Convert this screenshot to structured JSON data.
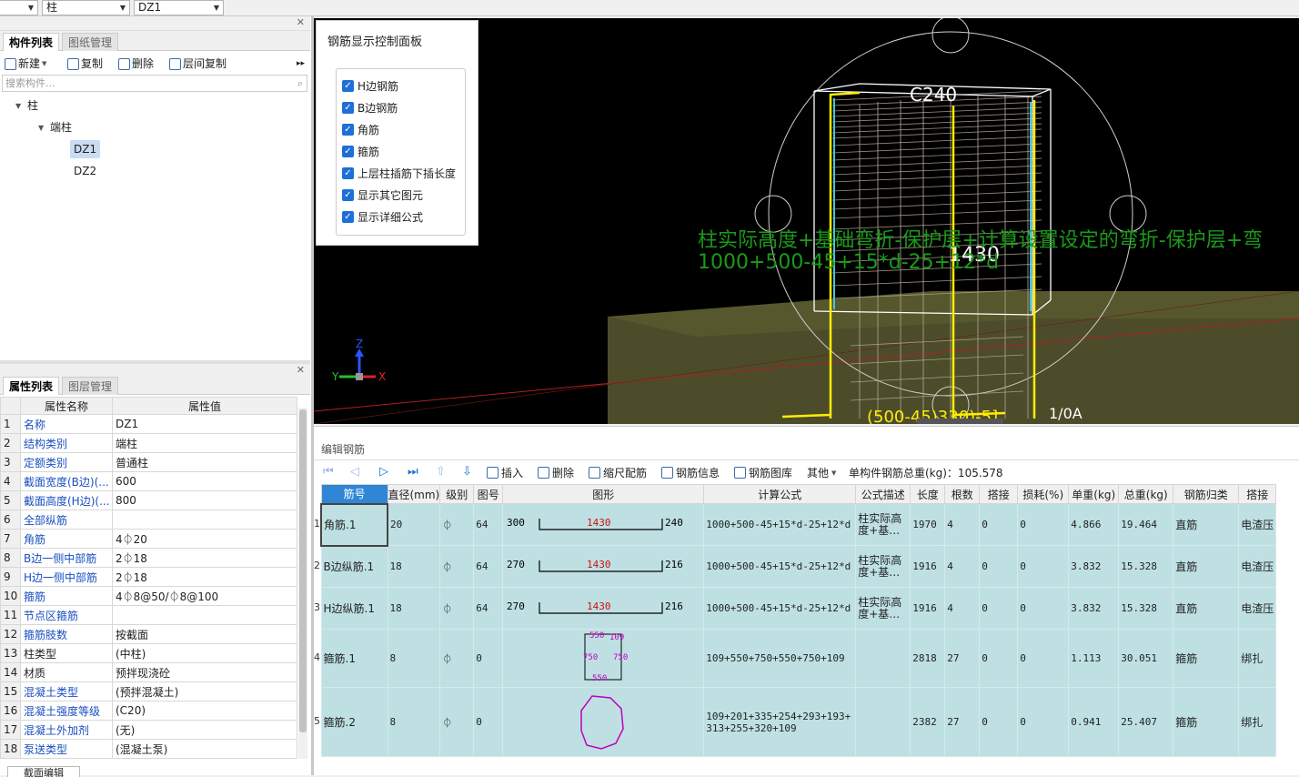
{
  "top_toolbar": {
    "combo1": "",
    "combo2": "柱",
    "combo3": "DZ1"
  },
  "component_panel": {
    "tabs": [
      "构件列表",
      "图纸管理"
    ],
    "toolbar": {
      "new": "新建",
      "copy": "复制",
      "delete": "删除",
      "floor_copy": "层间复制"
    },
    "search_placeholder": "搜索构件...",
    "tree": {
      "root": "柱",
      "group": "端柱",
      "items": [
        "DZ1",
        "DZ2"
      ]
    }
  },
  "property_panel": {
    "tabs": [
      "属性列表",
      "图层管理"
    ],
    "columns": [
      "属性名称",
      "属性值"
    ],
    "rows": [
      {
        "n": "1",
        "name": "名称",
        "value": "DZ1"
      },
      {
        "n": "2",
        "name": "结构类别",
        "value": "端柱"
      },
      {
        "n": "3",
        "name": "定额类别",
        "value": "普通柱"
      },
      {
        "n": "4",
        "name": "截面宽度(B边)(...",
        "value": "600"
      },
      {
        "n": "5",
        "name": "截面高度(H边)(...",
        "value": "800"
      },
      {
        "n": "6",
        "name": "全部纵筋",
        "value": ""
      },
      {
        "n": "7",
        "name": "角筋",
        "value": "4⏀20"
      },
      {
        "n": "8",
        "name": "B边一侧中部筋",
        "value": "2⏀18"
      },
      {
        "n": "9",
        "name": "H边一侧中部筋",
        "value": "2⏀18"
      },
      {
        "n": "10",
        "name": "箍筋",
        "value": "4⏀8@50/⏀8@100"
      },
      {
        "n": "11",
        "name": "节点区箍筋",
        "value": ""
      },
      {
        "n": "12",
        "name": "箍筋肢数",
        "value": "按截面"
      },
      {
        "n": "13",
        "name": "柱类型",
        "value": "(中柱)"
      },
      {
        "n": "14",
        "name": "材质",
        "value": "预拌现浇砼"
      },
      {
        "n": "15",
        "name": "混凝土类型",
        "value": "(预拌混凝土)"
      },
      {
        "n": "16",
        "name": "混凝土强度等级",
        "value": "(C20)"
      },
      {
        "n": "17",
        "name": "混凝土外加剂",
        "value": "(无)"
      },
      {
        "n": "18",
        "name": "泵送类型",
        "value": "(混凝土泵)"
      }
    ],
    "bottom_button": "截面编辑"
  },
  "viewport": {
    "label_top": "C240",
    "label_mid": "1430",
    "formula_line1": "柱实际高度+基础弯折-保护层+计算设置设定的弯折-保护层+弯",
    "formula_line2": "1000+500-45+15*d-25+12*d",
    "label_bottom": "(500-45)330)-5]",
    "label_bottom_right": "1/0A",
    "axis_z": "Z",
    "axis_y": "Y",
    "axis_x": "X"
  },
  "rebar_control_panel": {
    "title": "钢筋显示控制面板",
    "options": [
      "H边钢筋",
      "B边钢筋",
      "角筋",
      "箍筋",
      "上层柱插筋下插长度",
      "显示其它图元",
      "显示详细公式"
    ]
  },
  "edit_rebar": {
    "title": "编辑钢筋",
    "toolbar": {
      "insert": "插入",
      "delete": "删除",
      "scale": "缩尺配筋",
      "info": "钢筋信息",
      "library": "钢筋图库",
      "other": "其他",
      "total_label": "单构件钢筋总重(kg)：105.578"
    },
    "columns": [
      "筋号",
      "直径(mm)",
      "级别",
      "图号",
      "图形",
      "计算公式",
      "公式描述",
      "长度",
      "根数",
      "搭接",
      "损耗(%)",
      "单重(kg)",
      "总重(kg)",
      "钢筋归类",
      "搭接"
    ],
    "rows": [
      {
        "no": "1",
        "name": "角筋.1",
        "dia": "20",
        "grade": "⏀",
        "fig": "64",
        "left": "300",
        "mid": "1430",
        "right": "240",
        "formula": "1000+500-45+15*d-25+12*d",
        "desc": "柱实际高度+基…",
        "len": "1970",
        "count": "4",
        "lap": "0",
        "loss": "0",
        "unit": "4.866",
        "total": "19.464",
        "type": "直筋",
        "lap2": "电渣压"
      },
      {
        "no": "2",
        "name": "B边纵筋.1",
        "dia": "18",
        "grade": "⏀",
        "fig": "64",
        "left": "270",
        "mid": "1430",
        "right": "216",
        "formula": "1000+500-45+15*d-25+12*d",
        "desc": "柱实际高度+基…",
        "len": "1916",
        "count": "4",
        "lap": "0",
        "loss": "0",
        "unit": "3.832",
        "total": "15.328",
        "type": "直筋",
        "lap2": "电渣压"
      },
      {
        "no": "3",
        "name": "H边纵筋.1",
        "dia": "18",
        "grade": "⏀",
        "fig": "64",
        "left": "270",
        "mid": "1430",
        "right": "216",
        "formula": "1000+500-45+15*d-25+12*d",
        "desc": "柱实际高度+基…",
        "len": "1916",
        "count": "4",
        "lap": "0",
        "loss": "0",
        "unit": "3.832",
        "total": "15.328",
        "type": "直筋",
        "lap2": "电渣压"
      },
      {
        "no": "4",
        "name": "箍筋.1",
        "dia": "8",
        "grade": "⏀",
        "fig": "0",
        "formula": "109+550+750+550+750+109",
        "desc": "",
        "len": "2818",
        "count": "27",
        "lap": "0",
        "loss": "0",
        "unit": "1.113",
        "total": "30.051",
        "type": "箍筋",
        "lap2": "绑扎"
      },
      {
        "no": "5",
        "name": "箍筋.2",
        "dia": "8",
        "grade": "⏀",
        "fig": "0",
        "formula": "109+201+335+254+293+193+313+255+320+109",
        "desc": "",
        "len": "2382",
        "count": "27",
        "lap": "0",
        "loss": "0",
        "unit": "0.941",
        "total": "25.407",
        "type": "箍筋",
        "lap2": "绑扎"
      }
    ],
    "stirrup1": {
      "top": "550",
      "tr": "109",
      "left": "750",
      "right": "750",
      "bottom": "550"
    }
  }
}
